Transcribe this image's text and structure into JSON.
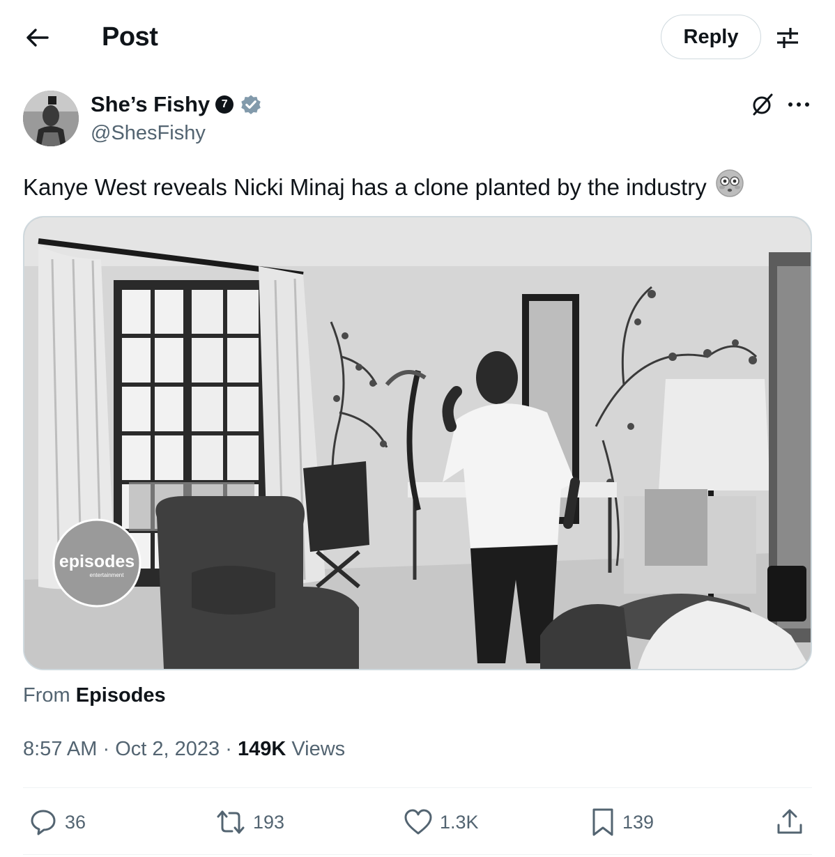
{
  "header": {
    "title": "Post",
    "back_icon": "arrow-left-icon",
    "reply_label": "Reply",
    "settings_icon": "sliders-icon"
  },
  "post": {
    "author": {
      "name": "She’s Fishy",
      "handle": "@ShesFishy",
      "badge_number": "7",
      "verified": true
    },
    "text": "Kanye West reveals Nicki Minaj has a clone planted by the industry",
    "emoji": "flushed-face",
    "media": {
      "type": "video",
      "watermark": "episodes",
      "watermark_sub": "entertainment"
    },
    "source": {
      "prefix": "From",
      "name": "Episodes"
    },
    "time": "8:57 AM",
    "separator": "·",
    "date": "Oct 2, 2023",
    "views_count": "149K",
    "views_label": "Views"
  },
  "actions": {
    "replies": "36",
    "reposts": "193",
    "likes": "1.3K",
    "bookmarks": "139"
  },
  "colors": {
    "text_primary": "#0f1419",
    "text_secondary": "#536471",
    "border": "#cfd9de",
    "divider": "#eff3f4",
    "verified_badge": "#829aab"
  }
}
